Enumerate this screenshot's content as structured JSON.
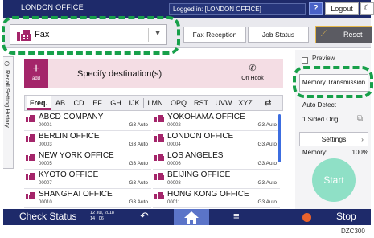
{
  "top_bar": {
    "office_label": "LONDON OFFICE",
    "logged_in": "Logged in: [LONDON OFFICE]",
    "help": "?",
    "logout": "Logout",
    "moon_icon": "moon-icon"
  },
  "toolbar": {
    "app_select": "Fax",
    "fax_reception": "Fax Reception",
    "job_status": "Job Status",
    "reset": "Reset"
  },
  "history_tab": "Recall Setting History",
  "destination": {
    "add_label": "add",
    "specify": "Specify destination(s)",
    "on_hook": "On Hook"
  },
  "tabs": [
    "Freq.",
    "AB",
    "CD",
    "EF",
    "GH",
    "IJK",
    "LMN",
    "OPQ",
    "RST",
    "UVW",
    "XYZ"
  ],
  "entries": [
    {
      "name": "ABCD COMPANY",
      "code": "00001",
      "group": "G3 Auto"
    },
    {
      "name": "YOKOHAMA OFFICE",
      "code": "00002",
      "group": "G3 Auto"
    },
    {
      "name": "BERLIN OFFICE",
      "code": "00003",
      "group": "G3 Auto"
    },
    {
      "name": "LONDON OFFICE",
      "code": "00004",
      "group": "G3 Auto"
    },
    {
      "name": "NEW YORK OFFICE",
      "code": "00005",
      "group": "G3 Auto"
    },
    {
      "name": "LOS ANGELES",
      "code": "00006",
      "group": "G3 Auto"
    },
    {
      "name": "KYOTO OFFICE",
      "code": "00007",
      "group": "G3 Auto"
    },
    {
      "name": "BEIJING OFFICE",
      "code": "00008",
      "group": "G3 Auto"
    },
    {
      "name": "SHANGHAI  OFFICE",
      "code": "00010",
      "group": "G3 Auto"
    },
    {
      "name": "HONG KONG OFFICE",
      "code": "00011",
      "group": "G3 Auto"
    }
  ],
  "right_panel": {
    "preview": "Preview",
    "memory_transmission": "Memory Transmission",
    "auto_detect": "Auto Detect",
    "sided": "1 Sided Orig.",
    "settings": "Settings",
    "memory_label": "Memory:",
    "memory_value": "100%",
    "start": "Start"
  },
  "bottom_bar": {
    "check_status": "Check Status",
    "date": "12 Jul, 2018",
    "time": "14 : 06",
    "stop": "Stop"
  },
  "figure_code": "DZC300",
  "colors": {
    "header": "#1e2a6a",
    "accent": "#a4256a",
    "highlight": "#17a04a",
    "start": "#8fe0c6",
    "reset_border": "#e6b84a"
  }
}
